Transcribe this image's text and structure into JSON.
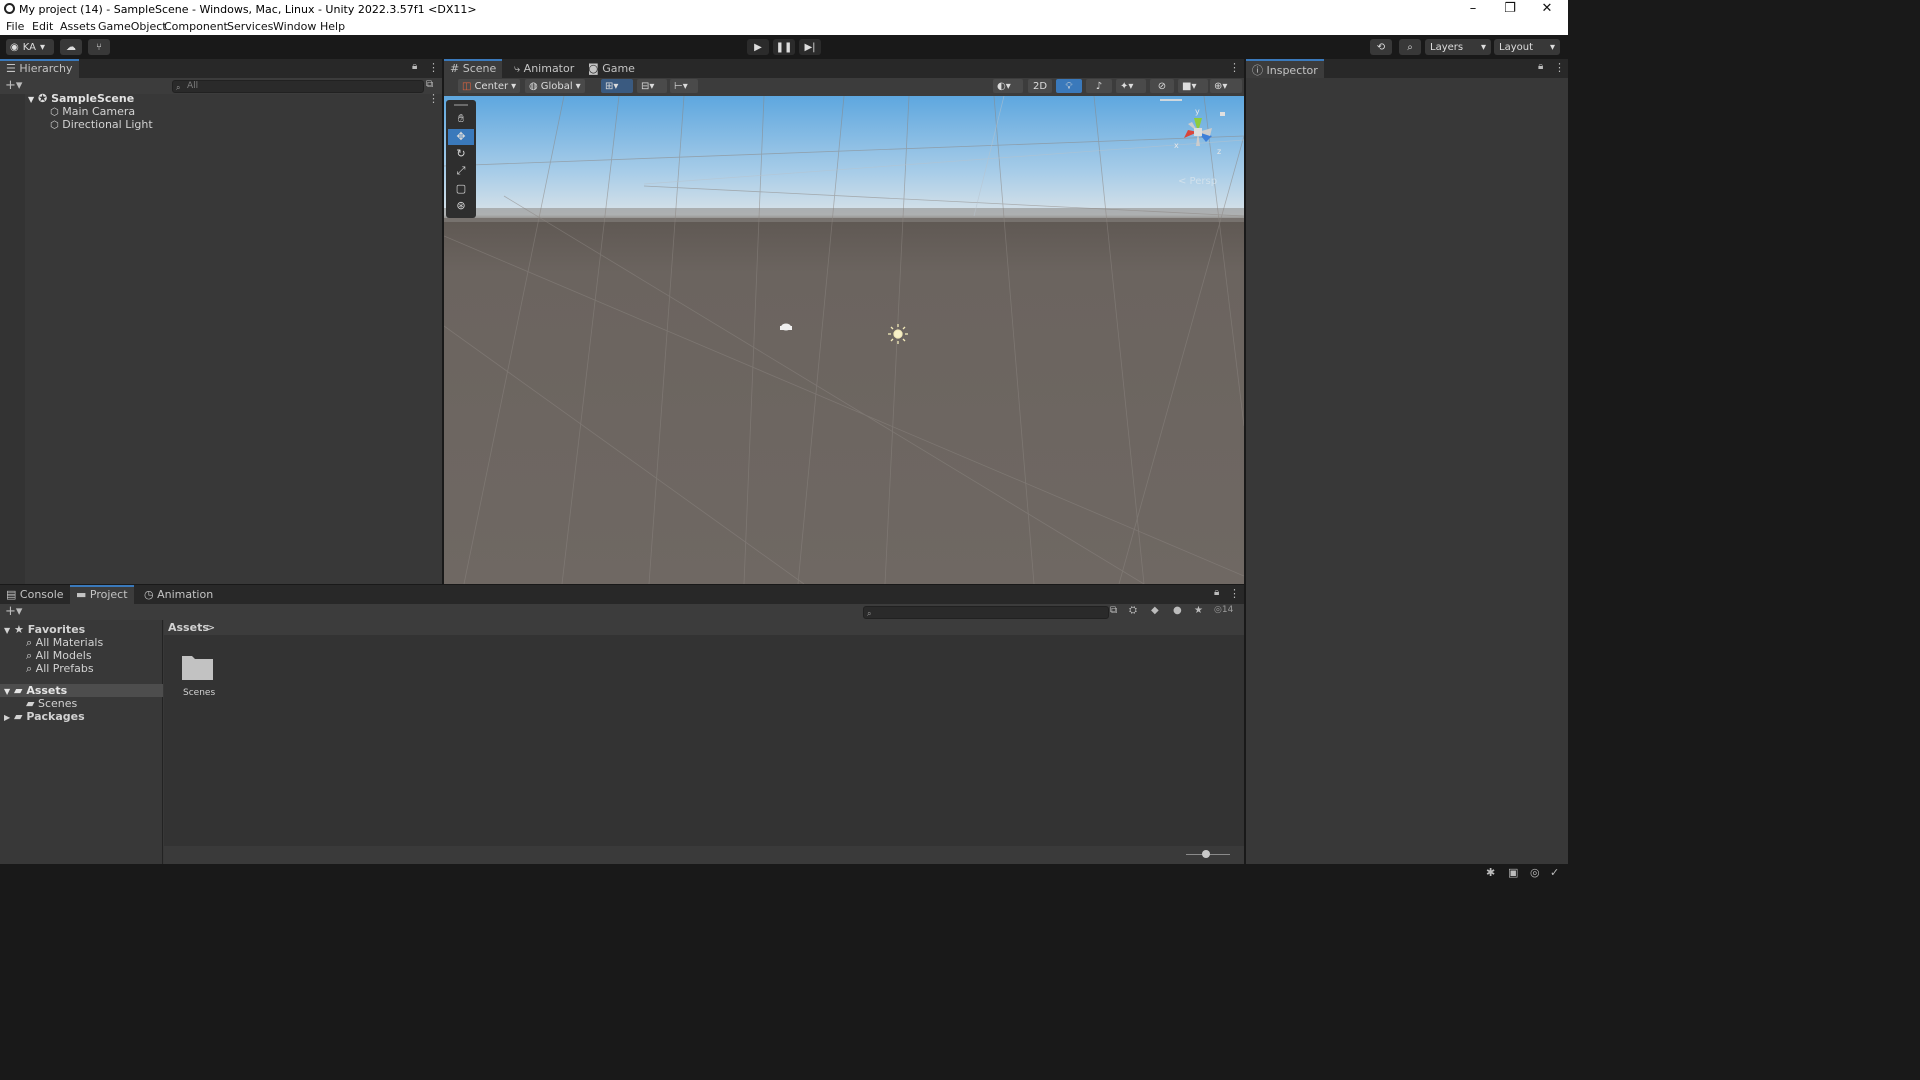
{
  "window": {
    "title": "My project (14) - SampleScene - Windows, Mac, Linux - Unity 2022.3.57f1 <DX11>",
    "minimize": "–",
    "restore": "❐",
    "close": "✕"
  },
  "menu": [
    "File",
    "Edit",
    "Assets",
    "GameObject",
    "Component",
    "Services",
    "Window",
    "Help"
  ],
  "toolbar": {
    "account": "KA",
    "layers": "Layers",
    "layout": "Layout"
  },
  "hierarchy": {
    "tab": "Hierarchy",
    "search_placeholder": "All",
    "scene": "SampleScene",
    "items": [
      "Main Camera",
      "Directional Light"
    ]
  },
  "scene_view": {
    "tabs": [
      "Scene",
      "Animator",
      "Game"
    ],
    "pivot": "Center",
    "space": "Global",
    "mode2d": "2D",
    "gizmo_label": "< Persp",
    "gizmo_axes": {
      "y": "y",
      "x": "x",
      "z": "z"
    },
    "colors": {
      "sky_top": "#6aaee0",
      "horizon": "#c9d7e2",
      "ground": "#6e6762"
    }
  },
  "inspector": {
    "tab": "Inspector"
  },
  "bottom": {
    "tabs": [
      "Console",
      "Project",
      "Animation"
    ],
    "favorites": {
      "label": "Favorites",
      "items": [
        "All Materials",
        "All Models",
        "All Prefabs"
      ]
    },
    "tree": {
      "assets": "Assets",
      "scenes": "Scenes",
      "packages": "Packages"
    },
    "breadcrumb": "Assets",
    "breadcrumb_sep": ">",
    "folders": [
      "Scenes"
    ],
    "hidden_count": "14"
  },
  "accent": "#3a79bb"
}
